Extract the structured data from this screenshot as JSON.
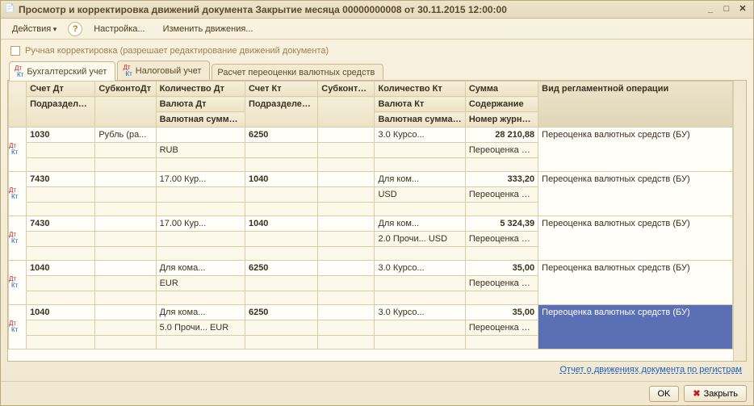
{
  "window": {
    "title": "Просмотр и корректировка движений документа Закрытие месяца 00000000008 от 30.11.2015 12:00:00"
  },
  "toolbar": {
    "actions": "Действия",
    "settings": "Настройка...",
    "change": "Изменить движения..."
  },
  "manual_edit_label": "Ручная корректировка (разрешает редактирование движений документа)",
  "tabs": {
    "acc": "Бухгалтерский учет",
    "tax": "Налоговый учет",
    "fx": "Расчет переоценки валютных средств"
  },
  "headers": {
    "r1": {
      "schet_dt": "Счет Дт",
      "subk_dt": "СубконтоДт",
      "qty_dt": "Количество Дт",
      "schet_kt": "Счет Кт",
      "subk_kt": "СубконтоКт",
      "qty_kt": "Количество Кт",
      "sum": "Сумма",
      "op": "Вид регламентной операции"
    },
    "r2": {
      "podr_dt": "Подразделение Дт",
      "val_dt": "Валюта Дт",
      "podr_kt": "Подразделение Кт",
      "val_kt": "Валюта Кт",
      "cont": "Содержание"
    },
    "r3": {
      "vsum_dt": "Валютная сумма Дт",
      "vsum_kt": "Валютная сумма Кт",
      "jrn": "Номер журнала"
    }
  },
  "rows": [
    {
      "schet_dt": "1030",
      "subk_dt": "Рубль (ра...",
      "qty_dt": "",
      "schet_kt": "6250",
      "subk_kt": "",
      "qty_kt": "3.0 Курсо...",
      "sum": "28 210,88",
      "op": "Переоценка валютных средств (БУ)",
      "val_dt": "",
      "cur_dt": "RUB",
      "val_kt": "",
      "cur_kt": "",
      "cont": "Переоценка ва...",
      "sub2_dt": "",
      "vs_dt": "",
      "sub2_kt": "",
      "vs_kt": "",
      "jrn": ""
    },
    {
      "schet_dt": "7430",
      "subk_dt": "",
      "qty_dt": "17.00 Кур...",
      "schet_kt": "1040",
      "subk_kt": "",
      "qty_kt": "Для ком...",
      "sum": "333,20",
      "op": "Переоценка валютных средств (БУ)",
      "val_dt": "",
      "cur_dt": "",
      "val_kt": "",
      "cur_kt": "USD",
      "cont": "Переоценка ва...",
      "sub2_dt": "",
      "vs_dt": "",
      "sub2_kt": "",
      "vs_kt": "",
      "jrn": ""
    },
    {
      "schet_dt": "7430",
      "subk_dt": "",
      "qty_dt": "17.00 Кур...",
      "schet_kt": "1040",
      "subk_kt": "",
      "qty_kt": "Для ком...",
      "sum": "5 324,39",
      "op": "Переоценка валютных средств (БУ)",
      "val_dt": "",
      "cur_dt": "",
      "val_kt": "",
      "cur_kt": "2.0 Прочи... USD",
      "cont": "Переоценка ва...",
      "sub2_dt": "",
      "vs_dt": "",
      "sub2_kt": "",
      "vs_kt": "",
      "jrn": ""
    },
    {
      "schet_dt": "1040",
      "subk_dt": "",
      "qty_dt": "Для кома...",
      "schet_kt": "6250",
      "subk_kt": "",
      "qty_kt": "3.0 Курсо...",
      "sum": "35,00",
      "op": "Переоценка валютных средств (БУ)",
      "val_dt": "",
      "cur_dt": "EUR",
      "val_kt": "",
      "cur_kt": "",
      "cont": "Переоценка ва...",
      "sub2_dt": "",
      "vs_dt": "",
      "sub2_kt": "",
      "vs_kt": "",
      "jrn": ""
    },
    {
      "schet_dt": "1040",
      "subk_dt": "",
      "qty_dt": "Для кома...",
      "schet_kt": "6250",
      "subk_kt": "",
      "qty_kt": "3.0 Курсо...",
      "sum": "35,00",
      "op": "Переоценка валютных средств (БУ)",
      "val_dt": "",
      "cur_dt": "5.0 Прочи... EUR",
      "val_kt": "",
      "cur_kt": "",
      "cont": "Переоценка ва...",
      "sub2_dt": "",
      "vs_dt": "",
      "sub2_kt": "",
      "vs_kt": "",
      "jrn": "",
      "selected": true
    }
  ],
  "footer": {
    "report_link": "Отчет о движениях документа по регистрам",
    "ok": "OK",
    "close": "Закрыть"
  }
}
